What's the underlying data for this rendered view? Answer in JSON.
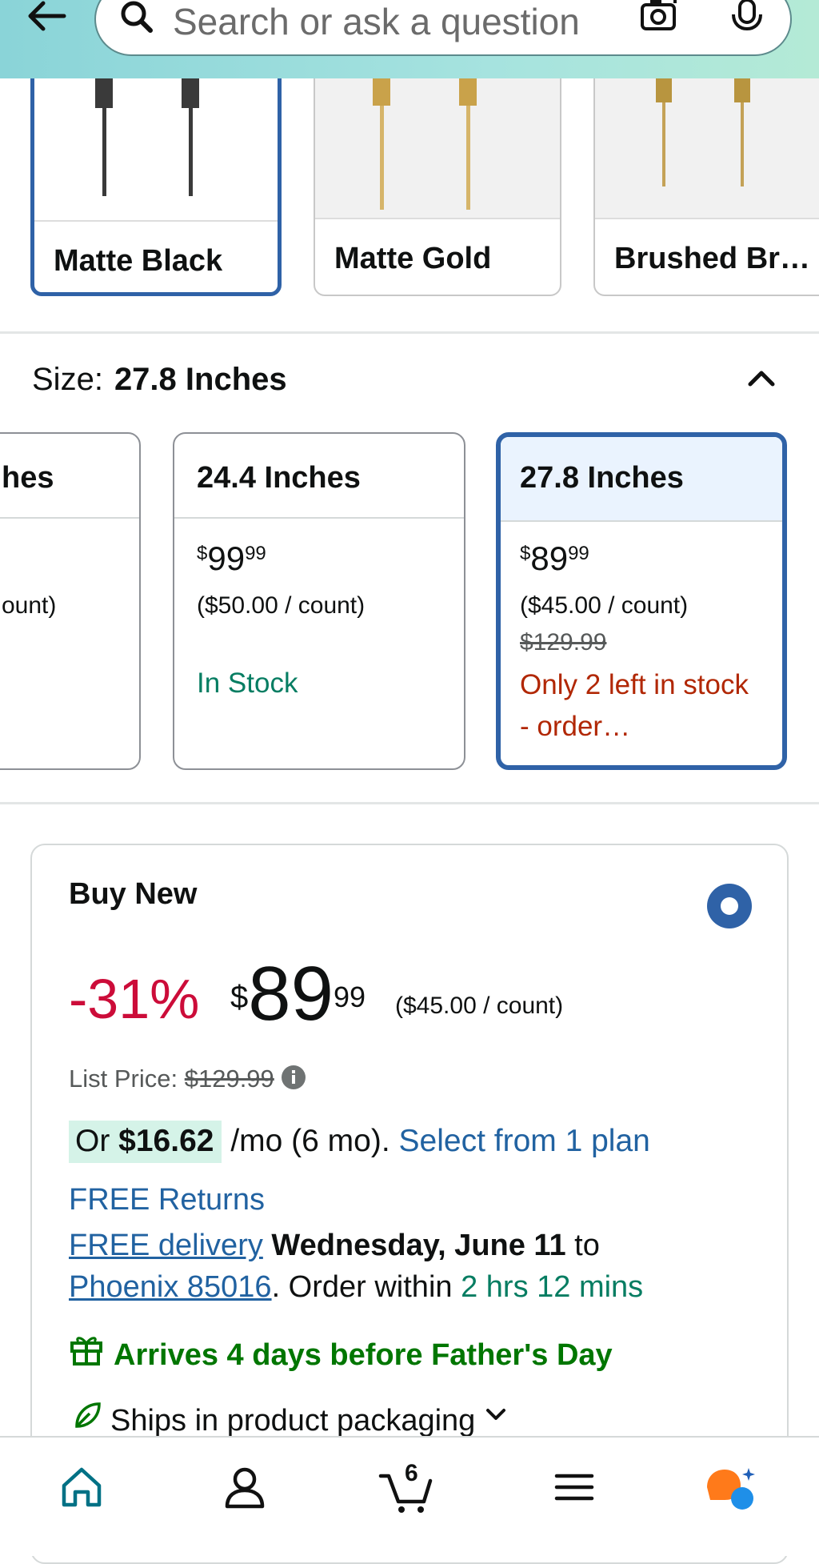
{
  "search": {
    "placeholder": "Search or ask a question"
  },
  "swatches": [
    {
      "name": "Matte Black",
      "selected": true
    },
    {
      "name": "Matte Gold",
      "selected": false
    },
    {
      "name": "Brushed Br…",
      "selected": false
    }
  ],
  "size": {
    "label": "Size:",
    "selected": "27.8 Inches",
    "cards": [
      {
        "title": "hes",
        "per_count": "ount)"
      },
      {
        "title": "24.4 Inches",
        "price_currency": "$",
        "price_whole": "99",
        "price_cents": "99",
        "per_count": "($50.00 / count)",
        "stock": "In Stock"
      },
      {
        "title": "27.8 Inches",
        "price_currency": "$",
        "price_whole": "89",
        "price_cents": "99",
        "per_count": "($45.00 / count)",
        "list_price": "$129.99",
        "stock": "Only 2 left in stock - order…"
      }
    ]
  },
  "buy": {
    "title": "Buy New",
    "discount": "-31%",
    "currency": "$",
    "price_whole": "89",
    "price_cents": "99",
    "per_count": "($45.00 / count)",
    "list_price_label": "List Price:",
    "list_price": "$129.99",
    "monthly_or": "Or",
    "monthly_amount": "$16.62",
    "monthly_term": "/mo (6 mo).",
    "monthly_link": "Select from 1 plan",
    "returns": "FREE Returns",
    "free_delivery": "FREE delivery",
    "delivery_date": "Wednesday, June 11",
    "delivery_to": "to",
    "location": "Phoenix 85016",
    "order_within": ". Order within",
    "time_left": "2 hrs 12 mins",
    "fathers_day": "Arrives 4 days before Father's Day",
    "ships": "Ships in product packaging"
  },
  "nav": {
    "cart_count": "6"
  },
  "colors": {
    "accent_blue": "#2f62a7",
    "link_blue": "#2162a1",
    "price_red": "#cc0c39",
    "stock_green": "#067d62",
    "alert_red": "#b12704"
  }
}
